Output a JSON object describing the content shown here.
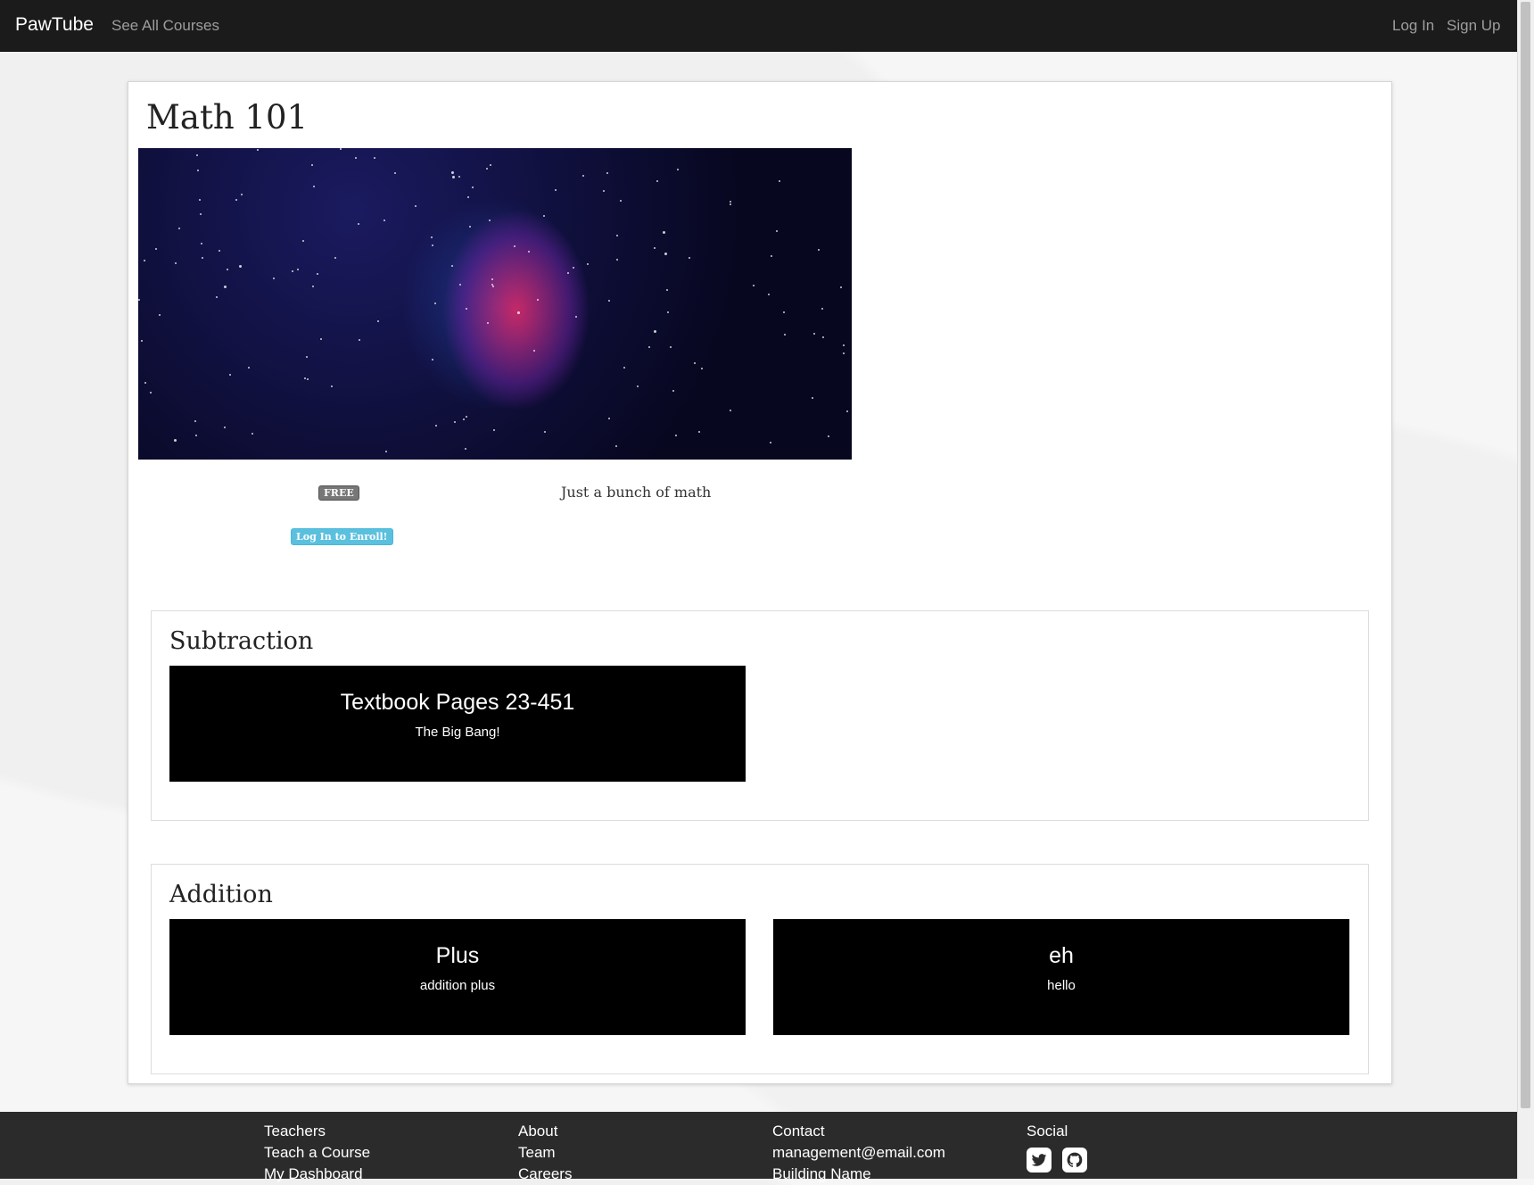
{
  "navbar": {
    "brand": "PawTube",
    "see_all": "See All Courses",
    "login": "Log In",
    "signup": "Sign Up"
  },
  "course": {
    "title": "Math 101",
    "price_badge": "FREE",
    "enroll_label": "Log In to Enroll!",
    "description": "Just a bunch of math"
  },
  "sections": [
    {
      "title": "Subtraction",
      "lessons": [
        {
          "title": "Textbook Pages 23-451",
          "subtitle": "The Big Bang!"
        }
      ]
    },
    {
      "title": "Addition",
      "lessons": [
        {
          "title": "Plus",
          "subtitle": "addition plus"
        },
        {
          "title": "eh",
          "subtitle": "hello"
        }
      ]
    }
  ],
  "footer": {
    "teachers": {
      "heading": "Teachers",
      "items": [
        "Teach a Course",
        "My Dashboard"
      ]
    },
    "about": {
      "heading": "About",
      "items": [
        "Team",
        "Careers"
      ]
    },
    "contact": {
      "heading": "Contact",
      "items": [
        "management@email.com",
        "Building Name"
      ]
    },
    "social": {
      "heading": "Social",
      "icons": [
        "twitter-icon",
        "github-icon"
      ]
    }
  }
}
